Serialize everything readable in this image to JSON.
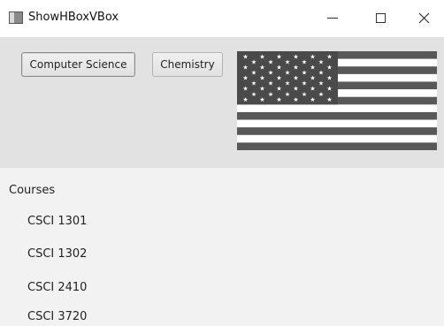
{
  "window": {
    "title": "ShowHBoxVBox",
    "controls": {
      "minimize_icon": "minimize-icon",
      "maximize_icon": "maximize-icon",
      "close_icon": "close-icon"
    }
  },
  "hbox": {
    "buttons": [
      {
        "label": "Computer Science"
      },
      {
        "label": "Chemistry"
      }
    ],
    "image": "us-flag"
  },
  "vbox": {
    "heading": "Courses",
    "courses": [
      "CSCI 1301",
      "CSCI 1302",
      "CSCI 2410",
      "CSCI 3720"
    ]
  },
  "colors": {
    "hbox_background": "#e2e2e2",
    "vbox_background": "#f2f2f2",
    "flag_stripe_dark": "#585858",
    "flag_stripe_light": "#ffffff",
    "flag_canton": "#4a4a4a"
  }
}
